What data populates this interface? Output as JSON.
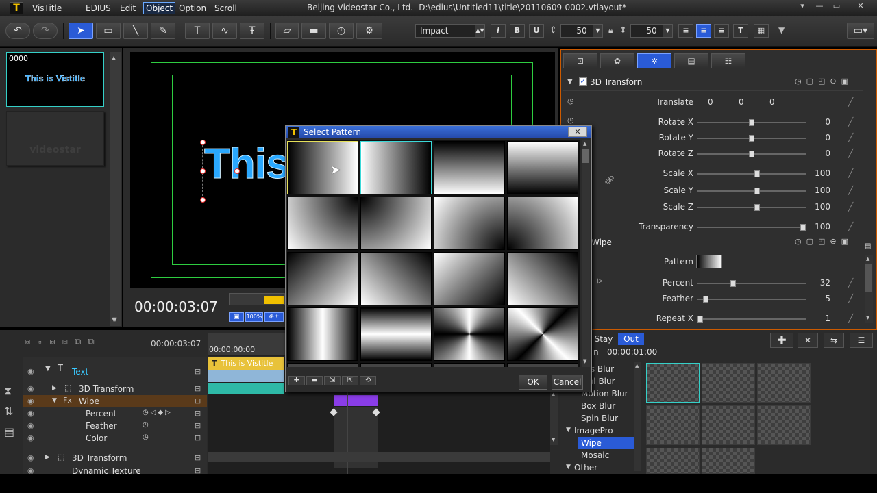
{
  "app": {
    "name": "VisTitle",
    "menus": [
      "EDIUS",
      "Edit",
      "Object",
      "Option",
      "Scroll"
    ],
    "active_menu": "Object",
    "window_title": "Beijing Videostar Co., Ltd. -D:\\edius\\Untitled11\\title\\20110609-0002.vtlayout*"
  },
  "toolbar": {
    "font": "Impact",
    "font_size": "50",
    "line_spacing": "50",
    "italic": "I",
    "bold": "B",
    "underline": "U"
  },
  "thumbnails": {
    "first_id": "0000",
    "first_text": "This is Vistitle",
    "second_text": "videostar"
  },
  "preview": {
    "canvas_text": "This",
    "timecode": "00:00:03:07",
    "zoom": "100%"
  },
  "properties": {
    "section1_title": "3D Transforn",
    "translate_label": "Translate",
    "translate_values": [
      "0",
      "0",
      "0"
    ],
    "rows": [
      {
        "label": "Rotate X",
        "value": "0",
        "pos": 0.5
      },
      {
        "label": "Rotate Y",
        "value": "0",
        "pos": 0.5
      },
      {
        "label": "Rotate Z",
        "value": "0",
        "pos": 0.5
      },
      {
        "label": "Scale X",
        "value": "100",
        "pos": 0.55
      },
      {
        "label": "Scale Y",
        "value": "100",
        "pos": 0.55
      },
      {
        "label": "Scale Z",
        "value": "100",
        "pos": 0.55
      },
      {
        "label": "Transparency",
        "value": "100",
        "pos": 1.0
      }
    ],
    "section2_title": "Wipe",
    "pattern_label": "Pattern",
    "wipe_rows": [
      {
        "label": "Percent",
        "value": "32",
        "pos": 0.32
      },
      {
        "label": "Feather",
        "value": "5",
        "pos": 0.05
      },
      {
        "label": "Repeat X",
        "value": "1",
        "pos": 0.0
      }
    ]
  },
  "timeline": {
    "timecode": "00:00:03:07",
    "ruler_start": "00:00:00:00",
    "clip_text": "This is Vistitle",
    "tracks": [
      {
        "label": "Text",
        "highlight": true
      },
      {
        "label": "3D Transform"
      },
      {
        "label": "Wipe"
      },
      {
        "label": "Percent"
      },
      {
        "label": "Feather"
      },
      {
        "label": "Color"
      },
      {
        "label": "3D Transform"
      },
      {
        "label": "Dynamic Texture"
      }
    ]
  },
  "effects": {
    "tabs": [
      "Stay",
      "Out"
    ],
    "active_tab": "Out",
    "duration_prefix": "n",
    "duration": "00:00:01:00",
    "list": [
      {
        "label": "uss Blur"
      },
      {
        "label": "dial Blur"
      },
      {
        "label": "Motion Blur"
      },
      {
        "label": "Box Blur"
      },
      {
        "label": "Spin Blur"
      },
      {
        "label": "ImagePro",
        "group": true
      },
      {
        "label": "Wipe",
        "selected": true
      },
      {
        "label": "Mosaic"
      },
      {
        "label": "Other",
        "group": true
      }
    ]
  },
  "dialog": {
    "title": "Select Pattern",
    "ok": "OK",
    "cancel": "Cancel",
    "patterns": [
      "pat-h-dark-left",
      "pat-h-dark-right",
      "pat-v-light-top",
      "pat-v-dark-top",
      "pat-corner-tl",
      "pat-corner-tr",
      "pat-corner-bl",
      "pat-corner-br",
      "pat-diag-1",
      "pat-diag-2",
      "pat-diag-3",
      "pat-diag-4",
      "pat-v-center",
      "pat-h-center",
      "pat-radial-cross-1",
      "pat-radial-cross-2"
    ]
  },
  "colors": {
    "accent": "#2a5bd7",
    "panel_border": "#cc5a00",
    "safe_area": "#2ecc40",
    "text_blue": "#2aa8ff"
  }
}
